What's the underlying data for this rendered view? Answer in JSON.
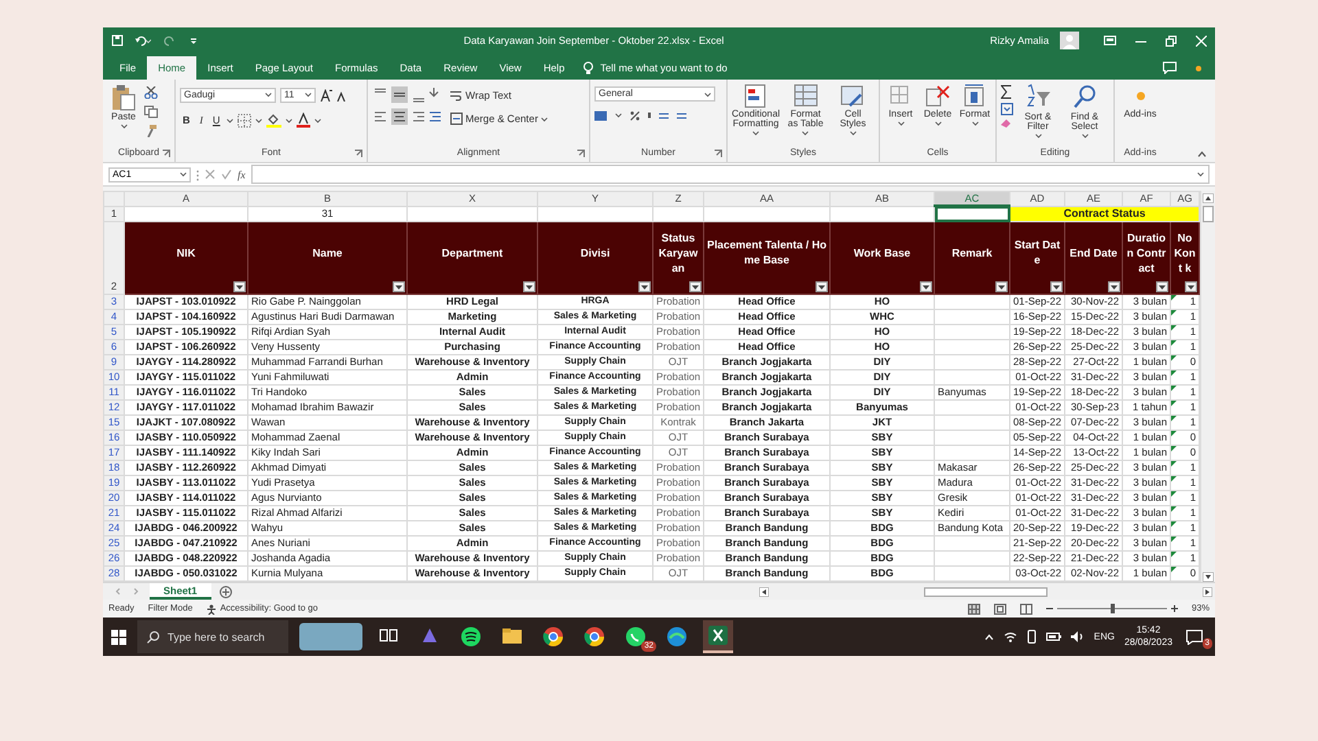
{
  "window": {
    "title": "Data Karyawan Join September - Oktober 22.xlsx  -  Excel",
    "user": "Rizky Amalia"
  },
  "ribbon_tabs": [
    {
      "label": "File",
      "selected": false
    },
    {
      "label": "Home",
      "selected": true
    },
    {
      "label": "Insert",
      "selected": false
    },
    {
      "label": "Page Layout",
      "selected": false
    },
    {
      "label": "Formulas",
      "selected": false
    },
    {
      "label": "Data",
      "selected": false
    },
    {
      "label": "Review",
      "selected": false
    },
    {
      "label": "View",
      "selected": false
    },
    {
      "label": "Help",
      "selected": false
    }
  ],
  "tell_me": "Tell me what you want to do",
  "ribbon": {
    "clipboard": {
      "paste": "Paste",
      "label": "Clipboard"
    },
    "font": {
      "name": "Gadugi",
      "size": "11",
      "styles": [
        "B",
        "I",
        "U"
      ],
      "label": "Font"
    },
    "alignment": {
      "wrap_text": "Wrap Text",
      "merge_center": "Merge & Center",
      "label": "Alignment"
    },
    "number": {
      "format": "General",
      "label": "Number"
    },
    "styles": {
      "buttons": [
        "Conditional Formatting",
        "Format as Table",
        "Cell Styles"
      ],
      "label": "Styles"
    },
    "cells": {
      "buttons": [
        "Insert",
        "Delete",
        "Format"
      ],
      "label": "Cells"
    },
    "editing": {
      "buttons": [
        "Sort & Filter",
        "Find & Select"
      ],
      "label": "Editing"
    },
    "add_ins": {
      "buttons": [
        "Add-ins"
      ],
      "label": "Add-ins"
    }
  },
  "formula_bar": {
    "name_box": "AC1",
    "function_label": "fx"
  },
  "columns": [
    {
      "label": "A",
      "selected": false
    },
    {
      "label": "B",
      "selected": false
    },
    {
      "label": "X",
      "selected": false
    },
    {
      "label": "Y",
      "selected": false
    },
    {
      "label": "Z",
      "selected": false
    },
    {
      "label": "AA",
      "selected": false
    },
    {
      "label": "AB",
      "selected": false
    },
    {
      "label": "AC",
      "selected": true
    },
    {
      "label": "AD",
      "selected": false
    },
    {
      "label": "AE",
      "selected": false
    },
    {
      "label": "AF",
      "selected": false
    },
    {
      "label": "AG",
      "selected": false
    }
  ],
  "row_1": {
    "number": "1",
    "b": "31",
    "contract_status": "Contract Status"
  },
  "header_row": {
    "number": "2",
    "labels": [
      "NIK",
      "Name",
      "Department",
      "Divisi",
      "Status Karyawan",
      "Placement Talenta / Home Base",
      "Work Base",
      "Remark",
      "Start Date",
      "End Date",
      "Duration Contract",
      "No Kont k"
    ]
  },
  "rows": [
    {
      "number": "3",
      "nik": "IJAPST - 103.010922",
      "name": "Rio Gabe P. Nainggolan",
      "department": "HRD Legal",
      "divisi": "HRGA",
      "status": "Probation",
      "placement": "Head Office",
      "work_base": "HO",
      "start": "01-Sep-22",
      "end": "30-Nov-22",
      "duration": "3 bulan",
      "no": "1"
    },
    {
      "number": "4",
      "nik": "IJAPST - 104.160922",
      "name": "Agustinus Hari Budi Darmawan",
      "department": "Marketing",
      "divisi": "Sales & Marketing",
      "status": "Probation",
      "placement": "Head Office",
      "work_base": "WHC",
      "start": "16-Sep-22",
      "end": "15-Dec-22",
      "duration": "3 bulan",
      "no": "1"
    },
    {
      "number": "5",
      "nik": "IJAPST - 105.190922",
      "name": "Rifqi Ardian Syah",
      "department": "Internal Audit",
      "divisi": "Internal Audit",
      "status": "Probation",
      "placement": "Head Office",
      "work_base": "HO",
      "start": "19-Sep-22",
      "end": "18-Dec-22",
      "duration": "3 bulan",
      "no": "1"
    },
    {
      "number": "6",
      "nik": "IJAPST - 106.260922",
      "name": "Veny Hussenty",
      "department": "Purchasing",
      "divisi": "Finance Accounting",
      "status": "Probation",
      "placement": "Head Office",
      "work_base": "HO",
      "start": "26-Sep-22",
      "end": "25-Dec-22",
      "duration": "3 bulan",
      "no": "1"
    },
    {
      "number": "9",
      "nik": "IJAYGY - 114.280922",
      "name": "Muhammad Farrandi Burhan",
      "department": "Warehouse & Inventory",
      "divisi": "Supply Chain",
      "status": "OJT",
      "placement": "Branch Jogjakarta",
      "work_base": "DIY",
      "start": "28-Sep-22",
      "end": "27-Oct-22",
      "duration": "1 bulan",
      "no": "0"
    },
    {
      "number": "10",
      "nik": "IJAYGY - 115.011022",
      "name": "Yuni Fahmiluwati",
      "department": "Admin",
      "divisi": "Finance Accounting",
      "status": "Probation",
      "placement": "Branch Jogjakarta",
      "work_base": "DIY",
      "start": "01-Oct-22",
      "end": "31-Dec-22",
      "duration": "3 bulan",
      "no": "1"
    },
    {
      "number": "11",
      "nik": "IJAYGY - 116.011022",
      "name": "Tri Handoko",
      "department": "Sales",
      "divisi": "Sales & Marketing",
      "status": "Probation",
      "placement": "Branch Jogjakarta",
      "work_base": "DIY",
      "remark": "Banyumas",
      "start": "19-Sep-22",
      "end": "18-Dec-22",
      "duration": "3 bulan",
      "no": "1"
    },
    {
      "number": "12",
      "nik": "IJAYGY - 117.011022",
      "name": "Mohamad Ibrahim Bawazir",
      "department": "Sales",
      "divisi": "Sales & Marketing",
      "status": "Probation",
      "placement": "Branch Jogjakarta",
      "work_base": "Banyumas",
      "start": "01-Oct-22",
      "end": "30-Sep-23",
      "duration": "1 tahun",
      "no": "1"
    },
    {
      "number": "15",
      "nik": "IJAJKT - 107.080922",
      "name": "Wawan",
      "department": "Warehouse & Inventory",
      "divisi": "Supply Chain",
      "status": "Kontrak",
      "placement": "Branch Jakarta",
      "work_base": "JKT",
      "start": "08-Sep-22",
      "end": "07-Dec-22",
      "duration": "3 bulan",
      "no": "1"
    },
    {
      "number": "16",
      "nik": "IJASBY - 110.050922",
      "name": "Mohammad Zaenal",
      "department": "Warehouse & Inventory",
      "divisi": "Supply Chain",
      "status": "OJT",
      "placement": "Branch Surabaya",
      "work_base": "SBY",
      "start": "05-Sep-22",
      "end": "04-Oct-22",
      "duration": "1 bulan",
      "no": "0"
    },
    {
      "number": "17",
      "nik": "IJASBY - 111.140922",
      "name": "Kiky Indah Sari",
      "department": "Admin",
      "divisi": "Finance Accounting",
      "status": "OJT",
      "placement": "Branch Surabaya",
      "work_base": "SBY",
      "start": "14-Sep-22",
      "end": "13-Oct-22",
      "duration": "1 bulan",
      "no": "0"
    },
    {
      "number": "18",
      "nik": "IJASBY - 112.260922",
      "name": "Akhmad Dimyati",
      "department": "Sales",
      "divisi": "Sales & Marketing",
      "status": "Probation",
      "placement": "Branch Surabaya",
      "work_base": "SBY",
      "remark": "Makasar",
      "start": "26-Sep-22",
      "end": "25-Dec-22",
      "duration": "3 bulan",
      "no": "1"
    },
    {
      "number": "19",
      "nik": "IJASBY - 113.011022",
      "name": "Yudi Prasetya",
      "department": "Sales",
      "divisi": "Sales & Marketing",
      "status": "Probation",
      "placement": "Branch Surabaya",
      "work_base": "SBY",
      "remark": "Madura",
      "start": "01-Oct-22",
      "end": "31-Dec-22",
      "duration": "3 bulan",
      "no": "1"
    },
    {
      "number": "20",
      "nik": "IJASBY - 114.011022",
      "name": "Agus Nurvianto",
      "department": "Sales",
      "divisi": "Sales & Marketing",
      "status": "Probation",
      "placement": "Branch Surabaya",
      "work_base": "SBY",
      "remark": "Gresik",
      "start": "01-Oct-22",
      "end": "31-Dec-22",
      "duration": "3 bulan",
      "no": "1"
    },
    {
      "number": "21",
      "nik": "IJASBY - 115.011022",
      "name": "Rizal Ahmad Alfarizi",
      "department": "Sales",
      "divisi": "Sales & Marketing",
      "status": "Probation",
      "placement": "Branch Surabaya",
      "work_base": "SBY",
      "remark": "Kediri",
      "start": "01-Oct-22",
      "end": "31-Dec-22",
      "duration": "3 bulan",
      "no": "1"
    },
    {
      "number": "24",
      "nik": "IJABDG - 046.200922",
      "name": "Wahyu",
      "department": "Sales",
      "divisi": "Sales & Marketing",
      "status": "Probation",
      "placement": "Branch Bandung",
      "work_base": "BDG",
      "remark": "Bandung Kota",
      "start": "20-Sep-22",
      "end": "19-Dec-22",
      "duration": "3 bulan",
      "no": "1"
    },
    {
      "number": "25",
      "nik": "IJABDG - 047.210922",
      "name": "Anes Nuriani",
      "department": "Admin",
      "divisi": "Finance Accounting",
      "status": "Probation",
      "placement": "Branch Bandung",
      "work_base": "BDG",
      "start": "21-Sep-22",
      "end": "20-Dec-22",
      "duration": "3 bulan",
      "no": "1"
    },
    {
      "number": "26",
      "nik": "IJABDG - 048.220922",
      "name": "Joshanda Agadia",
      "department": "Warehouse & Inventory",
      "divisi": "Supply Chain",
      "status": "Probation",
      "placement": "Branch Bandung",
      "work_base": "BDG",
      "start": "22-Sep-22",
      "end": "21-Dec-22",
      "duration": "3 bulan",
      "no": "1"
    },
    {
      "number": "28",
      "nik": "IJABDG - 050.031022",
      "name": "Kurnia Mulyana",
      "department": "Warehouse & Inventory",
      "divisi": "Supply Chain",
      "status": "OJT",
      "placement": "Branch Bandung",
      "work_base": "BDG",
      "start": "03-Oct-22",
      "end": "02-Nov-22",
      "duration": "1 bulan",
      "no": "0"
    }
  ],
  "sheet_tabs": [
    {
      "label": "Sheet1",
      "selected": true
    }
  ],
  "status_bar": {
    "ready": "Ready",
    "filter": "Filter Mode",
    "accessibility": "Accessibility: Good to go",
    "zoom": "93%",
    "zoom_slider": {
      "level": 0.5
    }
  },
  "taskbar": {
    "search_placeholder": "Type here to search",
    "whatsapp_badge": "32",
    "language": "ENG",
    "time": "15:42",
    "date": "28/08/2023",
    "notification_badge": "3"
  }
}
